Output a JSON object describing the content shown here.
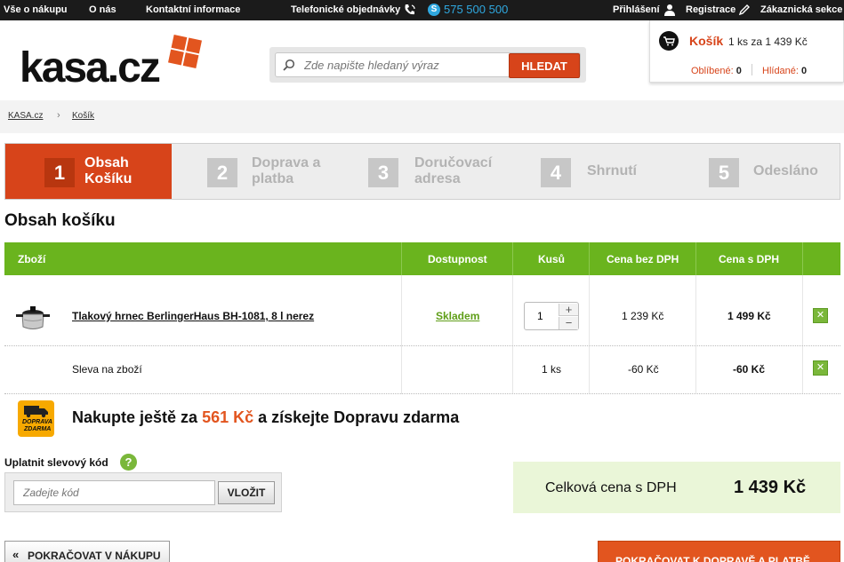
{
  "topbar": {
    "links": [
      "Vše o nákupu",
      "O nás",
      "Kontaktní informace"
    ],
    "phone_label": "Telefonické objednávky",
    "phone_number": "575 500 500",
    "login": "Přihlášení",
    "register": "Registrace",
    "customer_section": "Zákaznická sekce"
  },
  "header": {
    "logo": "kasa.cz",
    "search_placeholder": "Zde napište hledaný výraz",
    "search_button": "HLEDAT",
    "cart_title": "Košík",
    "cart_info": "1 ks za 1 439 Kč",
    "favorites_label": "Oblíbené:",
    "favorites_count": "0",
    "watched_label": "Hlídané:",
    "watched_count": "0"
  },
  "breadcrumb": [
    "KASA.cz",
    "Košík"
  ],
  "steps": [
    {
      "num": "1",
      "label1": "Obsah",
      "label2": "Košíku"
    },
    {
      "num": "2",
      "label1": "Doprava a",
      "label2": "platba"
    },
    {
      "num": "3",
      "label1": "Doručovací",
      "label2": "adresa"
    },
    {
      "num": "4",
      "label1": "Shrnutí",
      "label2": ""
    },
    {
      "num": "5",
      "label1": "Odesláno",
      "label2": ""
    }
  ],
  "section_title": "Obsah košíku",
  "table": {
    "headers": [
      "Zboží",
      "Dostupnost",
      "Kusů",
      "Cena bez DPH",
      "Cena s DPH"
    ],
    "product": {
      "name": "Tlakový hrnec BerlingerHaus BH-1081, 8 l nerez",
      "availability": "Skladem",
      "quantity": "1",
      "price_no_vat": "1 239 Kč",
      "price_vat": "1 499 Kč"
    },
    "discount": {
      "name": "Sleva na zboží",
      "quantity": "1 ks",
      "price_no_vat": "-60 Kč",
      "price_vat": "-60 Kč"
    }
  },
  "promo": {
    "icon_text1": "DOPRAVA",
    "icon_text2": "ZDARMA",
    "text_before": "Nakupte ještě za ",
    "amount": "561 Kč",
    "text_after": " a získejte Dopravu zdarma"
  },
  "coupon": {
    "label": "Uplatnit slevový kód",
    "placeholder": "Zadejte kód",
    "button": "VLOŽIT"
  },
  "total": {
    "label": "Celková cena s DPH",
    "value": "1 439 Kč"
  },
  "buttons": {
    "back": "POKRAČOVAT V NÁKUPU",
    "next": "POKRAČOVAT K DOPRAVĚ A PLATBĚ"
  },
  "colors": {
    "accent": "#d7441a",
    "green": "#6ab41e",
    "topbar": "#1b1b1b"
  }
}
